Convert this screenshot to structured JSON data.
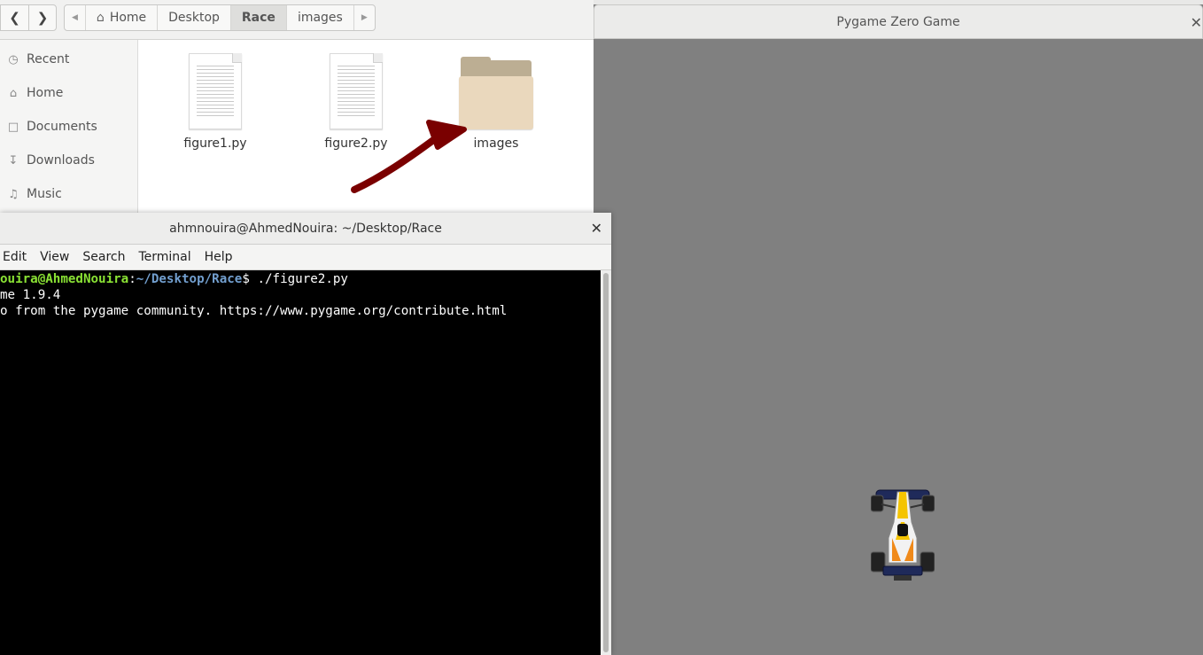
{
  "file_manager": {
    "breadcrumb": [
      "Home",
      "Desktop",
      "Race",
      "images"
    ],
    "active_segment": "Race",
    "sidebar": [
      {
        "label": "Recent",
        "icon": "clock-icon"
      },
      {
        "label": "Home",
        "icon": "home-icon"
      },
      {
        "label": "Documents",
        "icon": "document-icon"
      },
      {
        "label": "Downloads",
        "icon": "download-icon"
      },
      {
        "label": "Music",
        "icon": "music-icon"
      }
    ],
    "files": [
      {
        "name": "figure1.py",
        "type": "text-file"
      },
      {
        "name": "figure2.py",
        "type": "text-file"
      },
      {
        "name": "images",
        "type": "folder"
      }
    ]
  },
  "terminal": {
    "title": "ahmnouira@AhmedNouira: ~/Desktop/Race",
    "menu": [
      "Edit",
      "View",
      "Search",
      "Terminal",
      "Help"
    ],
    "prompt_user": "ouira@AhmedNouira",
    "prompt_sep": ":",
    "prompt_path": "~/Desktop/Race",
    "prompt_cmd": "$ ./figure2.py",
    "output": [
      "me 1.9.4",
      "o from the pygame community. https://www.pygame.org/contribute.html"
    ]
  },
  "pygame": {
    "title": "Pygame Zero Game"
  },
  "colors": {
    "prompt_user": "#8ae234",
    "prompt_path": "#729fcf",
    "annotation_arrow": "#7a0000",
    "game_background": "#808080"
  }
}
